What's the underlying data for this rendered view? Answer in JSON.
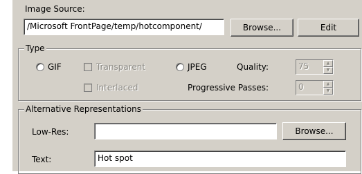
{
  "image_source": {
    "label": "Image Source:",
    "path_value": "/Microsoft FrontPage/temp/hotcomponent/",
    "browse_label": "Browse...",
    "edit_label": "Edit"
  },
  "type": {
    "title": "Type",
    "gif_label": "GIF",
    "transparent_label": "Transparent",
    "interlaced_label": "Interlaced",
    "jpeg_label": "JPEG",
    "quality_label": "Quality:",
    "quality_value": "75",
    "progressive_label": "Progressive Passes:",
    "progressive_value": "0"
  },
  "alternative": {
    "title": "Alternative Representations",
    "lowres_label": "Low-Res:",
    "lowres_value": "",
    "lowres_browse_label": "Browse...",
    "text_label": "Text:",
    "text_value": "Hot spot"
  }
}
